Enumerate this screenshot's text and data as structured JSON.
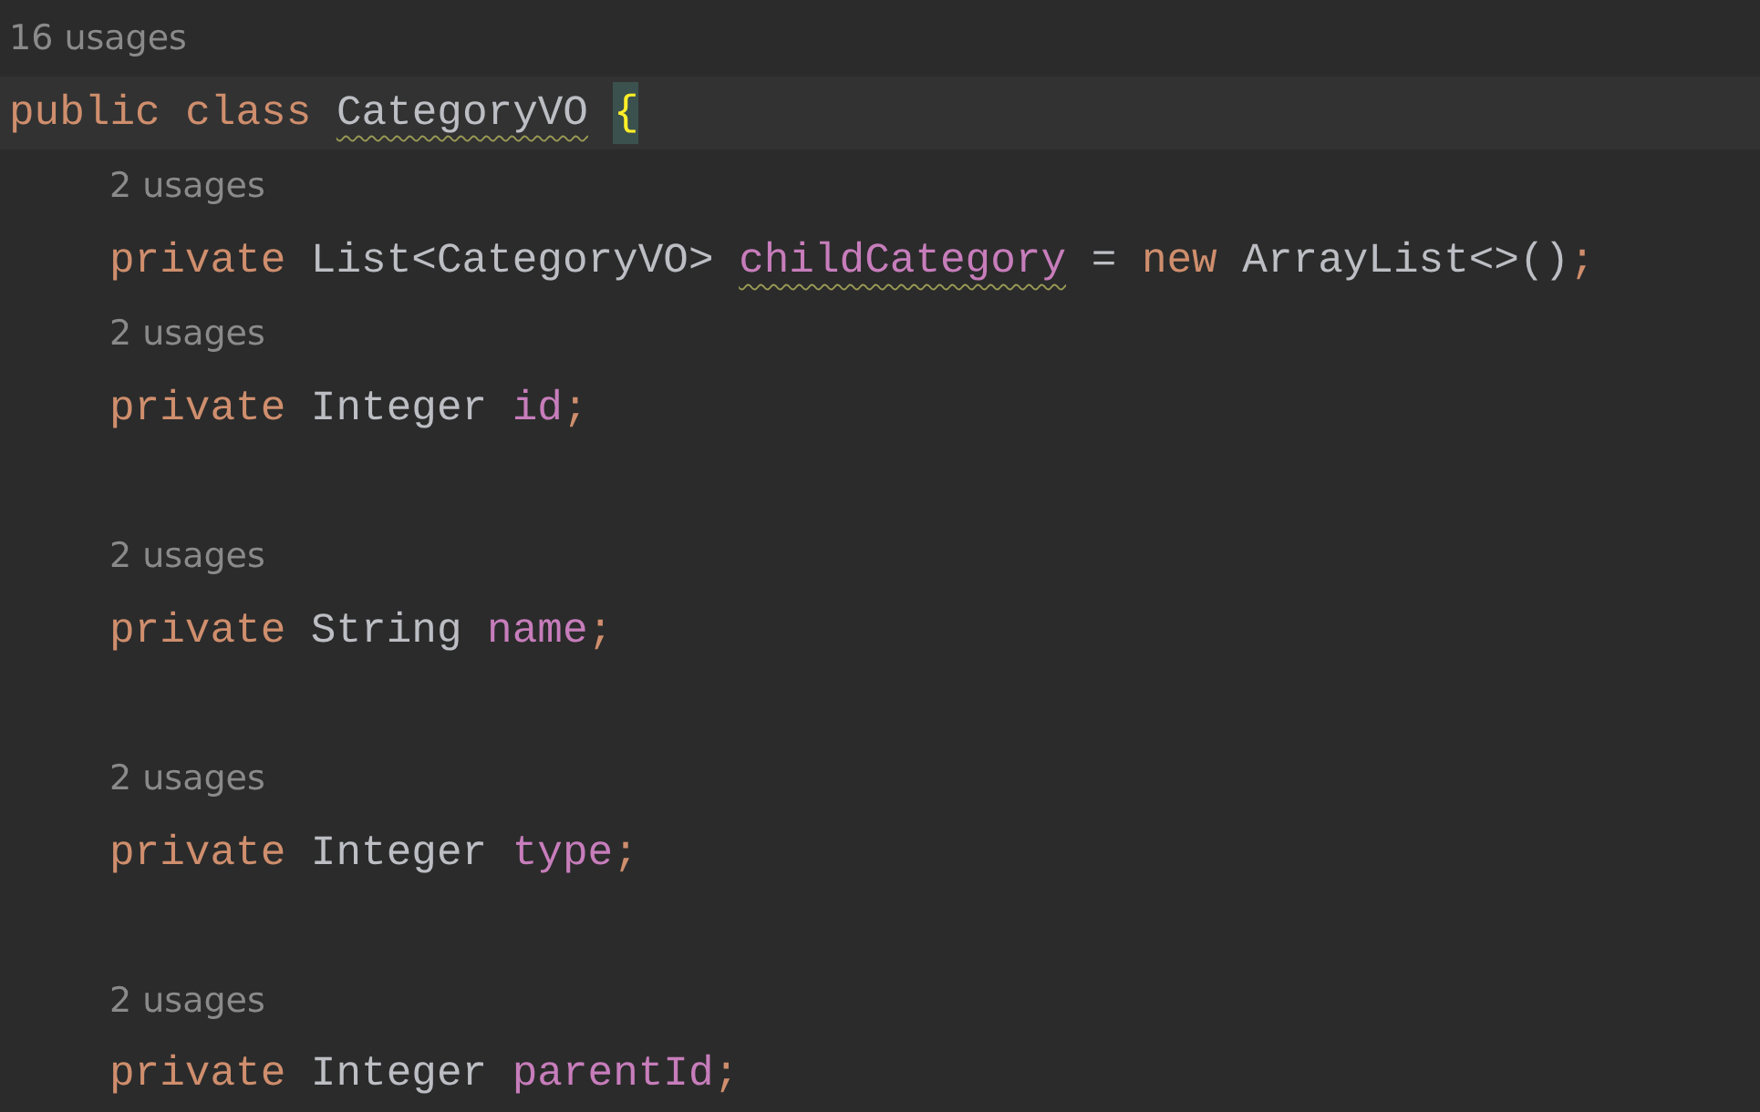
{
  "editor": {
    "class_usages": "16 usages",
    "declaration": {
      "tokens": [
        {
          "text": "public",
          "kind": "keyword",
          "warning": false,
          "matched": false
        },
        {
          "text": " class ",
          "kind": "keyword",
          "warning": false,
          "matched": false
        },
        {
          "text": "CategoryVO",
          "kind": "type",
          "warning": true,
          "matched": false
        },
        {
          "text": "{",
          "kind": "brace",
          "warning": false,
          "matched": true
        }
      ]
    },
    "members": [
      {
        "usages": "2 usages",
        "blank_before": false,
        "tokens": [
          {
            "text": "private",
            "kind": "keyword",
            "warning": false
          },
          {
            "text": " List<CategoryVO> ",
            "kind": "type",
            "warning": false
          },
          {
            "text": "childCategory",
            "kind": "field",
            "warning": true
          },
          {
            "text": " = ",
            "kind": "punct",
            "warning": false
          },
          {
            "text": "new",
            "kind": "keyword",
            "warning": false
          },
          {
            "text": " ArrayList<>()",
            "kind": "type",
            "warning": false
          },
          {
            "text": ";",
            "kind": "semicolon",
            "warning": false
          }
        ]
      },
      {
        "usages": "2 usages",
        "blank_before": false,
        "tokens": [
          {
            "text": "private",
            "kind": "keyword",
            "warning": false
          },
          {
            "text": " Integer ",
            "kind": "type",
            "warning": false
          },
          {
            "text": "id",
            "kind": "field",
            "warning": false
          },
          {
            "text": ";",
            "kind": "semicolon",
            "warning": false
          }
        ]
      },
      {
        "usages": "2 usages",
        "blank_before": true,
        "tokens": [
          {
            "text": "private",
            "kind": "keyword",
            "warning": false
          },
          {
            "text": " String ",
            "kind": "type",
            "warning": false
          },
          {
            "text": "name",
            "kind": "field",
            "warning": false
          },
          {
            "text": ";",
            "kind": "semicolon",
            "warning": false
          }
        ]
      },
      {
        "usages": "2 usages",
        "blank_before": true,
        "tokens": [
          {
            "text": "private",
            "kind": "keyword",
            "warning": false
          },
          {
            "text": " Integer ",
            "kind": "type",
            "warning": false
          },
          {
            "text": "type",
            "kind": "field",
            "warning": false
          },
          {
            "text": ";",
            "kind": "semicolon",
            "warning": false
          }
        ]
      },
      {
        "usages": "2 usages",
        "blank_before": true,
        "tokens": [
          {
            "text": "private",
            "kind": "keyword",
            "warning": false
          },
          {
            "text": " Integer ",
            "kind": "type",
            "warning": false
          },
          {
            "text": "parentId",
            "kind": "field",
            "warning": false
          },
          {
            "text": ";",
            "kind": "semicolon",
            "warning": false
          }
        ]
      }
    ]
  }
}
